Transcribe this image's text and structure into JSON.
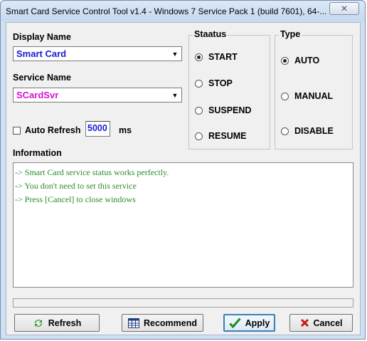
{
  "window": {
    "title": "Smart Card Service Control Tool v1.4 - Windows 7  Service Pack 1 (build 7601), 64-...",
    "close_glyph": "✕"
  },
  "display_name": {
    "label": "Display Name",
    "value": "Smart Card",
    "color": "#1a1ad8"
  },
  "service_name": {
    "label": "Service Name",
    "value": "SCardSvr",
    "color": "#d412d4"
  },
  "auto_refresh": {
    "label": "Auto Refresh",
    "value": "5000",
    "unit": "ms",
    "checked": false
  },
  "status_group": {
    "title": "Staatus",
    "options": [
      {
        "label": "START",
        "selected": true
      },
      {
        "label": "STOP",
        "selected": false
      },
      {
        "label": "SUSPEND",
        "selected": false
      },
      {
        "label": "RESUME",
        "selected": false
      }
    ]
  },
  "type_group": {
    "title": "Type",
    "options": [
      {
        "label": "AUTO",
        "selected": true
      },
      {
        "label": "MANUAL",
        "selected": false
      },
      {
        "label": "DISABLE",
        "selected": false
      }
    ]
  },
  "information": {
    "label": "Information",
    "lines": [
      "-> Smart Card service status works perfectly.",
      "-> You don't need to set this service",
      "-> Press [Cancel] to close windows"
    ],
    "color": "#2e8b2e"
  },
  "buttons": {
    "refresh": {
      "label": "Refresh",
      "icon": "refresh-icon"
    },
    "recommend": {
      "label": "Recommend",
      "icon": "table-icon"
    },
    "apply": {
      "label": "Apply",
      "icon": "check-icon"
    },
    "cancel": {
      "label": "Cancel",
      "icon": "x-icon"
    }
  }
}
